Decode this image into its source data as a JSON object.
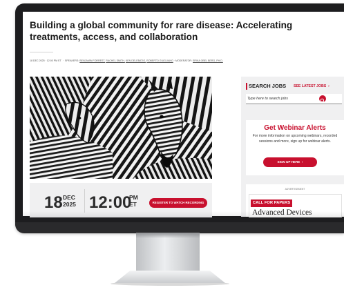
{
  "article": {
    "title": "Building a global community for rare disease: Accelerating treatments, access, and collaboration",
    "byline": {
      "date_time": "18 DEC 2025 · 12:00 PM ET",
      "speakers_label": "SPEAKERS:",
      "speakers": [
        "BENJAMIN FORREST,",
        "RACHEL SMITH,",
        "KEN DELEBATIO,",
        "ROBERTO GIUGLIANO"
      ],
      "moderator_label": "MODERATOR:",
      "moderator": "ERIKA OBEL BERG, PH.D."
    },
    "hero_image": "zebras-photo"
  },
  "event": {
    "day": "18",
    "month": "DEC",
    "year": "2025",
    "time": "12:00",
    "ampm": "PM",
    "tz": "ET",
    "register_label": "REGISTER TO WATCH RECORDING"
  },
  "search_jobs": {
    "title": "SEARCH JOBS",
    "latest_label": "SEE LATEST JOBS",
    "latest_icon": "chevron-right-icon",
    "placeholder": "Type here to search jobs",
    "search_icon": "search-icon"
  },
  "webinar_alerts": {
    "title": "Get Webinar Alerts",
    "description": "For more information on upcoming webinars, recorded sessions and more, sign up for webinar alerts.",
    "signup_label": "SIGN UP HERE"
  },
  "advertisement": {
    "label": "ADVERTISEMENT",
    "badge": "CALL FOR PAPERS",
    "headline": "Advanced Devices"
  },
  "colors": {
    "accent": "#c8102e",
    "panel": "#f0f0f1",
    "bezel": "#1d1d1f",
    "title_text": "#1a1a1a"
  }
}
